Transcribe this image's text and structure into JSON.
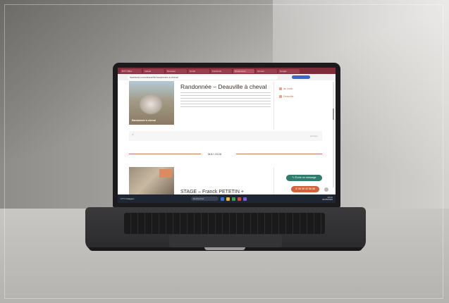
{
  "browser": {
    "tabs": [
      "RTT Office",
      "Indeed",
      "Nouveau",
      "Gmail",
      "Facebook",
      "Randonnée",
      "Accueil",
      "Google"
    ],
    "active_tab_index": 5,
    "url": "facebook.com/deauville/randonnee-a-cheval"
  },
  "page": {
    "event1": {
      "title": "Randonnée – Deauville à cheval",
      "thumb_caption": "Randonnée à cheval",
      "meta_time": "de matin",
      "meta_location": "Deauville"
    },
    "share_text": "partager",
    "month_label": "MAI 2026",
    "event2": {
      "title": "STAGE – Franck PETETIN +"
    },
    "buttons": {
      "message": "✎ Écrire un message",
      "phone": "✆ 06 39 42 56 88"
    }
  },
  "taskbar": {
    "weather": "17°C Nuageux",
    "search": "Rechercher",
    "clock_time": "10:42",
    "clock_date": "04/05/2026",
    "app_colors": [
      "#2f6fe0",
      "#f2b632",
      "#3a9e57",
      "#d14b3f",
      "#7a5cd6"
    ]
  },
  "colors": {
    "tab_bar": "#7e2b3a",
    "accent": "#c27a5e",
    "message_button": "#2f7d6f",
    "phone_button": "#d2633a"
  }
}
